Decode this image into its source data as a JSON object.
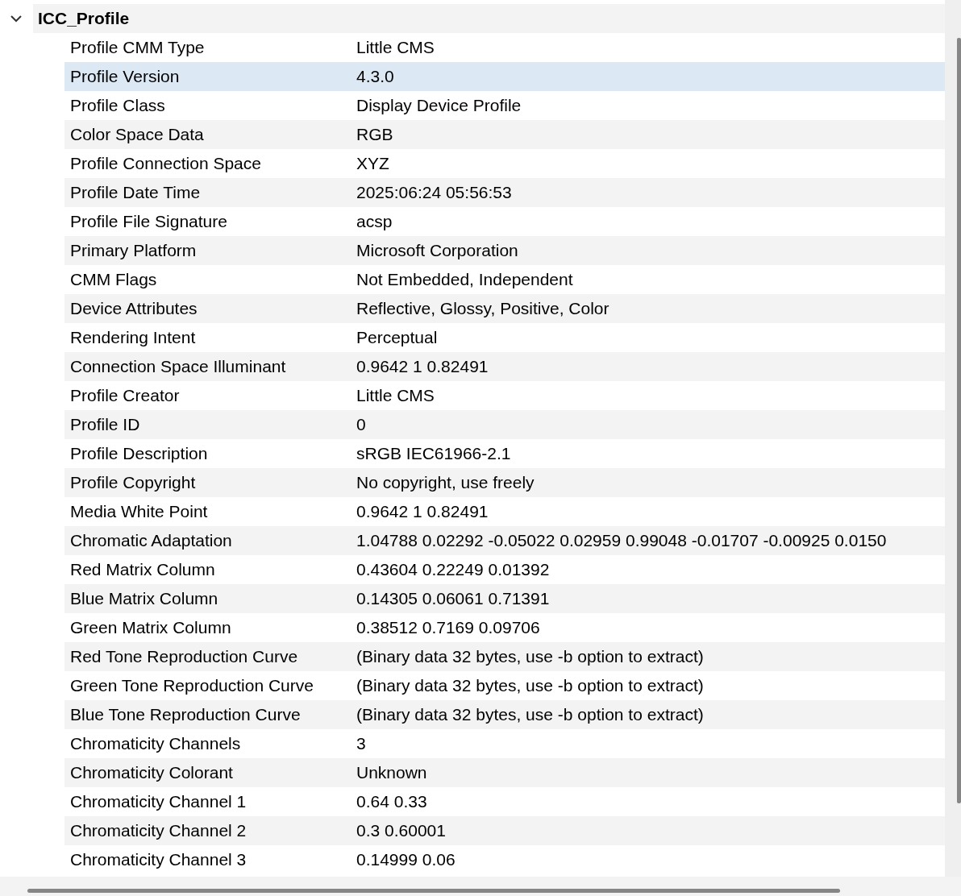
{
  "group": {
    "title": "ICC_Profile",
    "expanded": true,
    "rows": [
      {
        "key": "Profile CMM Type",
        "value": "Little CMS",
        "selected": false
      },
      {
        "key": "Profile Version",
        "value": "4.3.0",
        "selected": true
      },
      {
        "key": "Profile Class",
        "value": "Display Device Profile",
        "selected": false
      },
      {
        "key": "Color Space Data",
        "value": "RGB",
        "selected": false
      },
      {
        "key": "Profile Connection Space",
        "value": "XYZ",
        "selected": false
      },
      {
        "key": "Profile Date Time",
        "value": "2025:06:24 05:56:53",
        "selected": false
      },
      {
        "key": "Profile File Signature",
        "value": "acsp",
        "selected": false
      },
      {
        "key": "Primary Platform",
        "value": "Microsoft Corporation",
        "selected": false
      },
      {
        "key": "CMM Flags",
        "value": "Not Embedded, Independent",
        "selected": false
      },
      {
        "key": "Device Attributes",
        "value": "Reflective, Glossy, Positive, Color",
        "selected": false
      },
      {
        "key": "Rendering Intent",
        "value": "Perceptual",
        "selected": false
      },
      {
        "key": "Connection Space Illuminant",
        "value": "0.9642 1 0.82491",
        "selected": false
      },
      {
        "key": "Profile Creator",
        "value": "Little CMS",
        "selected": false
      },
      {
        "key": "Profile ID",
        "value": "0",
        "selected": false
      },
      {
        "key": "Profile Description",
        "value": "sRGB IEC61966-2.1",
        "selected": false
      },
      {
        "key": "Profile Copyright",
        "value": "No copyright, use freely",
        "selected": false
      },
      {
        "key": "Media White Point",
        "value": "0.9642 1 0.82491",
        "selected": false
      },
      {
        "key": "Chromatic Adaptation",
        "value": "1.04788 0.02292 -0.05022 0.02959 0.99048 -0.01707 -0.00925 0.0150",
        "selected": false
      },
      {
        "key": "Red Matrix Column",
        "value": "0.43604 0.22249 0.01392",
        "selected": false
      },
      {
        "key": "Blue Matrix Column",
        "value": "0.14305 0.06061 0.71391",
        "selected": false
      },
      {
        "key": "Green Matrix Column",
        "value": "0.38512 0.7169 0.09706",
        "selected": false
      },
      {
        "key": "Red Tone Reproduction Curve",
        "value": "(Binary data 32 bytes, use -b option to extract)",
        "selected": false
      },
      {
        "key": "Green Tone Reproduction Curve",
        "value": "(Binary data 32 bytes, use -b option to extract)",
        "selected": false
      },
      {
        "key": "Blue Tone Reproduction Curve",
        "value": "(Binary data 32 bytes, use -b option to extract)",
        "selected": false
      },
      {
        "key": "Chromaticity Channels",
        "value": "3",
        "selected": false
      },
      {
        "key": "Chromaticity Colorant",
        "value": "Unknown",
        "selected": false
      },
      {
        "key": "Chromaticity Channel 1",
        "value": "0.64 0.33",
        "selected": false
      },
      {
        "key": "Chromaticity Channel 2",
        "value": "0.3 0.60001",
        "selected": false
      },
      {
        "key": "Chromaticity Channel 3",
        "value": "0.14999 0.06",
        "selected": false
      }
    ]
  }
}
